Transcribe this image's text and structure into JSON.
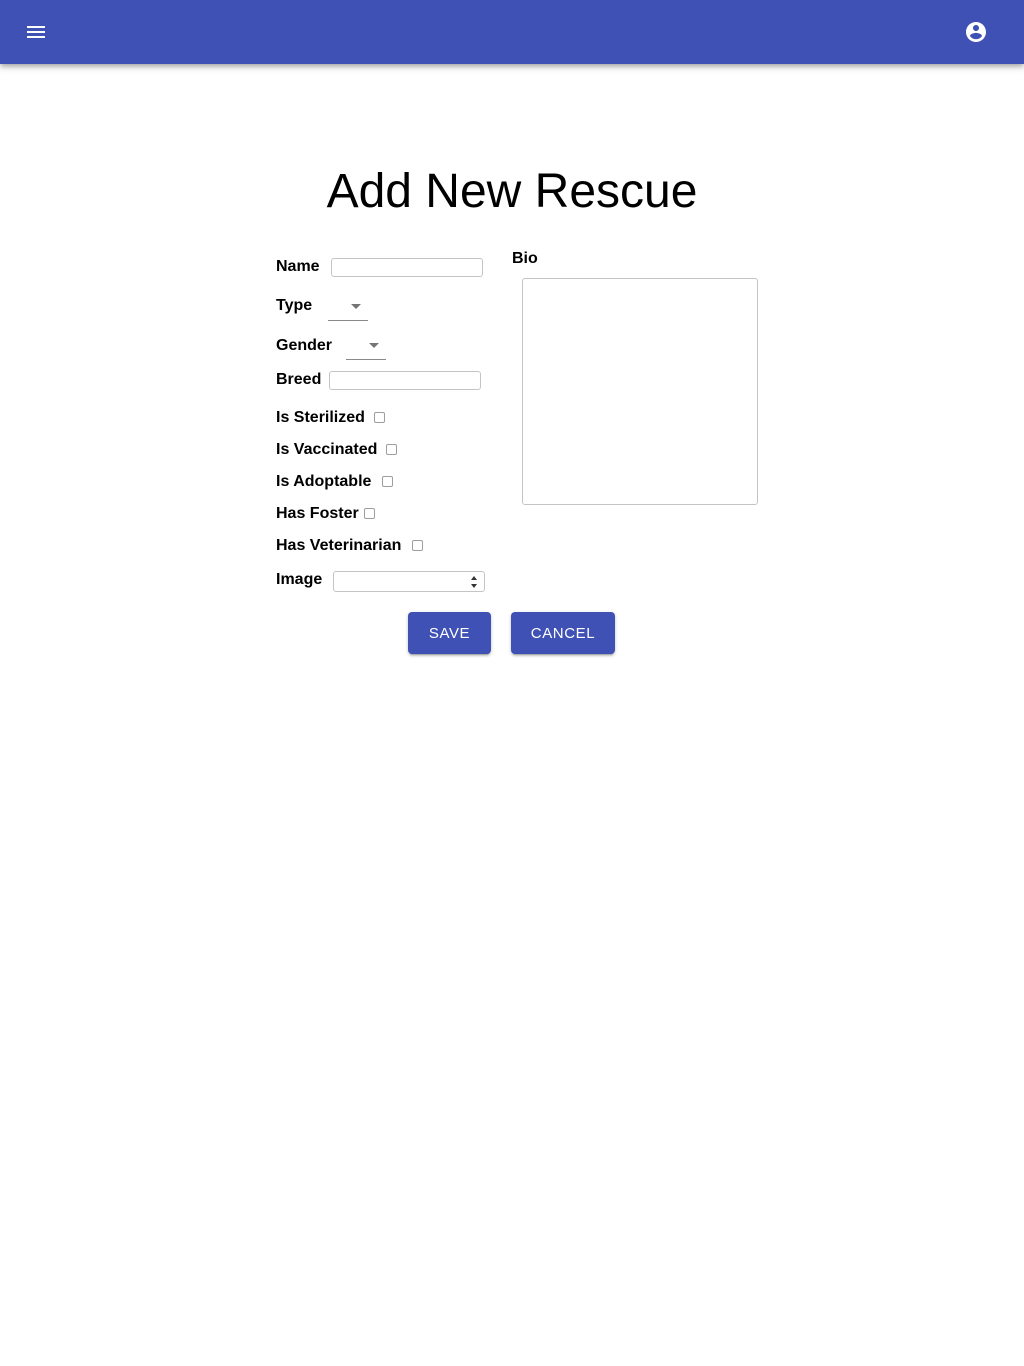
{
  "header": {
    "menu_icon": "menu-icon",
    "account_icon": "account-circle-icon",
    "color": "#3f51b5"
  },
  "page": {
    "title": "Add New Rescue"
  },
  "form": {
    "name": {
      "label": "Name",
      "value": ""
    },
    "type": {
      "label": "Type",
      "value": ""
    },
    "gender": {
      "label": "Gender",
      "value": ""
    },
    "breed": {
      "label": "Breed",
      "value": ""
    },
    "is_sterilized": {
      "label": "Is Sterilized",
      "checked": false
    },
    "is_vaccinated": {
      "label": "Is Vaccinated",
      "checked": false
    },
    "is_adoptable": {
      "label": "Is Adoptable",
      "checked": false
    },
    "has_foster": {
      "label": "Has Foster",
      "checked": false
    },
    "has_veterinarian": {
      "label": "Has Veterinarian",
      "checked": false
    },
    "image": {
      "label": "Image",
      "value": ""
    },
    "bio": {
      "label": "Bio",
      "value": ""
    }
  },
  "actions": {
    "save_label": "SAVE",
    "cancel_label": "CANCEL"
  }
}
